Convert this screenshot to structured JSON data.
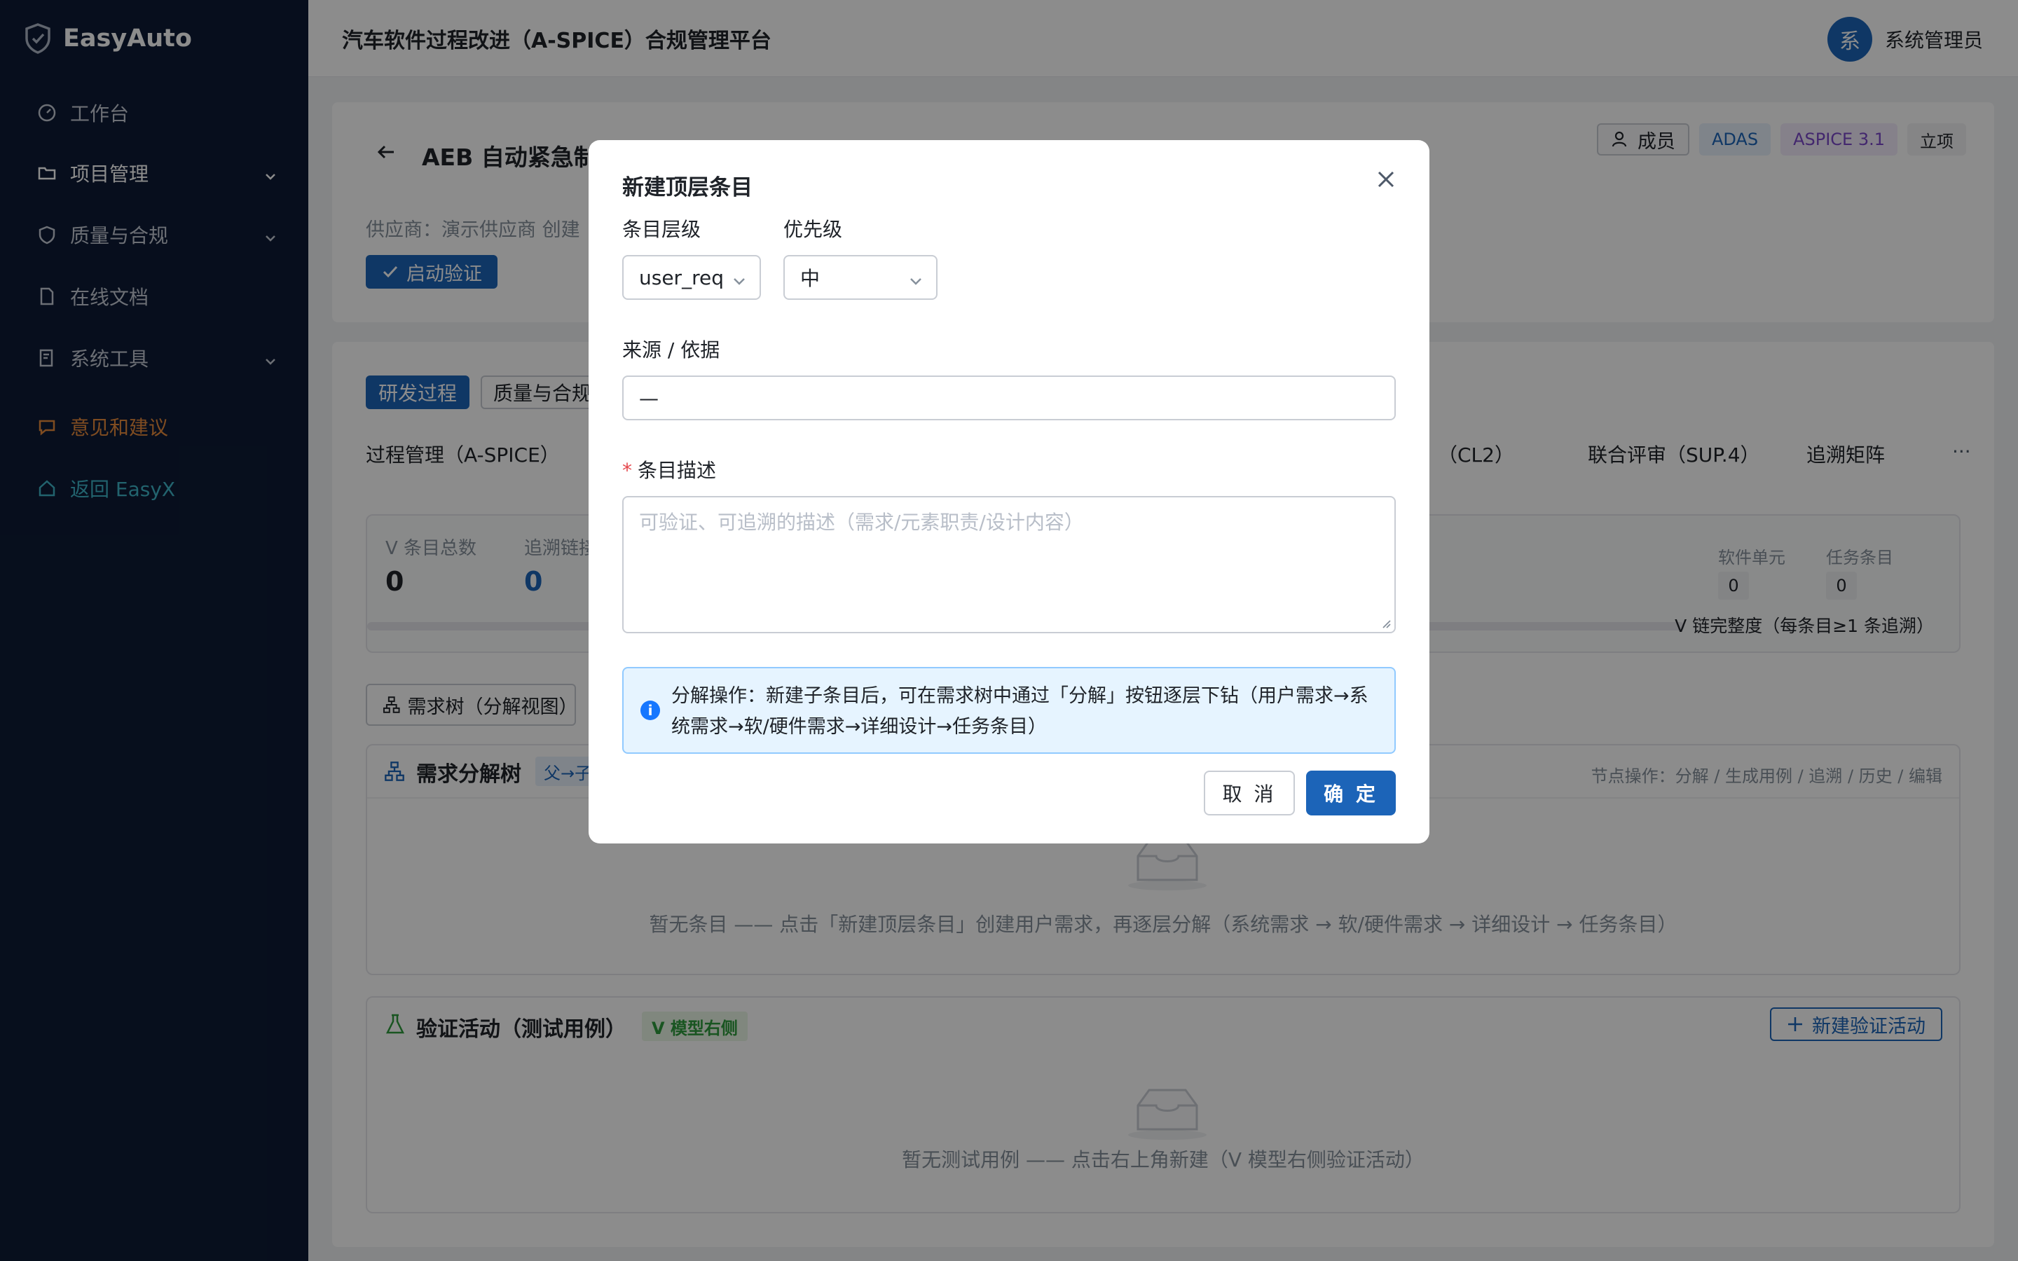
{
  "app": {
    "name": "EasyAuto",
    "platform_title": "汽车软件过程改进（A-SPICE）合规管理平台"
  },
  "sidebar": {
    "items": [
      {
        "label": "工作台",
        "icon": "dashboard-icon"
      },
      {
        "label": "项目管理",
        "icon": "folder-icon"
      },
      {
        "label": "质量与合规",
        "icon": "shield-icon"
      },
      {
        "label": "在线文档",
        "icon": "document-icon"
      },
      {
        "label": "系统工具",
        "icon": "tools-icon"
      },
      {
        "label": "意见和建议",
        "icon": "chat-icon"
      },
      {
        "label": "返回 EasyX",
        "icon": "home-icon"
      }
    ]
  },
  "user": {
    "avatar_text": "系",
    "name": "系统管理员"
  },
  "project": {
    "title": "AEB 自动紧急制动系统（端到端演示）",
    "tags": {
      "members": "成员",
      "domain": "ADAS",
      "standard": "ASPICE 3.1",
      "status": "立项"
    },
    "supplier_line": "供应商：演示供应商  创建",
    "start_button": "启动验证"
  },
  "process_tabs": [
    "研发过程",
    "质量与合规"
  ],
  "sub_tabs": [
    "过程管理（A-SPICE）",
    "（CL2）",
    "联合评审（SUP.4）",
    "追溯矩阵",
    "···"
  ],
  "stats": {
    "total_label": "V 条目总数",
    "total_value": "0",
    "trace_label": "追溯链接",
    "trace_value": "0",
    "unit_label": "软件单元",
    "unit_value": "0",
    "task_label": "任务条目",
    "task_value": "0",
    "chain_label": "V 链完整度（每条目≥1 条追溯）"
  },
  "tree": {
    "view_button": "需求树（分解视图）",
    "title": "需求分解树",
    "badge": "父→子",
    "node_ops": "节点操作：分解 / 生成用例 / 追溯 / 历史 / 编辑",
    "empty": "暂无条目 —— 点击「新建顶层条目」创建用户需求，再逐层分解（系统需求 → 软/硬件需求 → 详细设计 → 任务条目）"
  },
  "verify": {
    "title": "验证活动（测试用例）",
    "badge": "V 模型右侧",
    "new_button": "新建验证活动",
    "empty": "暂无测试用例 —— 点击右上角新建（V 模型右侧验证活动）"
  },
  "modal": {
    "title": "新建顶层条目",
    "level_label": "条目层级",
    "level_value": "user_req",
    "priority_label": "优先级",
    "priority_value": "中",
    "source_label": "来源 / 依据",
    "source_value": "—",
    "desc_label": "条目描述",
    "desc_placeholder": "可验证、可追溯的描述（需求/元素职责/设计内容）",
    "info": "分解操作：新建子条目后，可在需求树中通过「分解」按钮逐层下钻（用户需求→系统需求→软/硬件需求→详细设计→任务条目）",
    "cancel": "取 消",
    "ok": "确 定"
  },
  "colors": {
    "sidebar_bg": "#0d1b35",
    "primary": "#1c64b8",
    "feedback": "#e78a3c",
    "back_link": "#3fb5c8"
  }
}
